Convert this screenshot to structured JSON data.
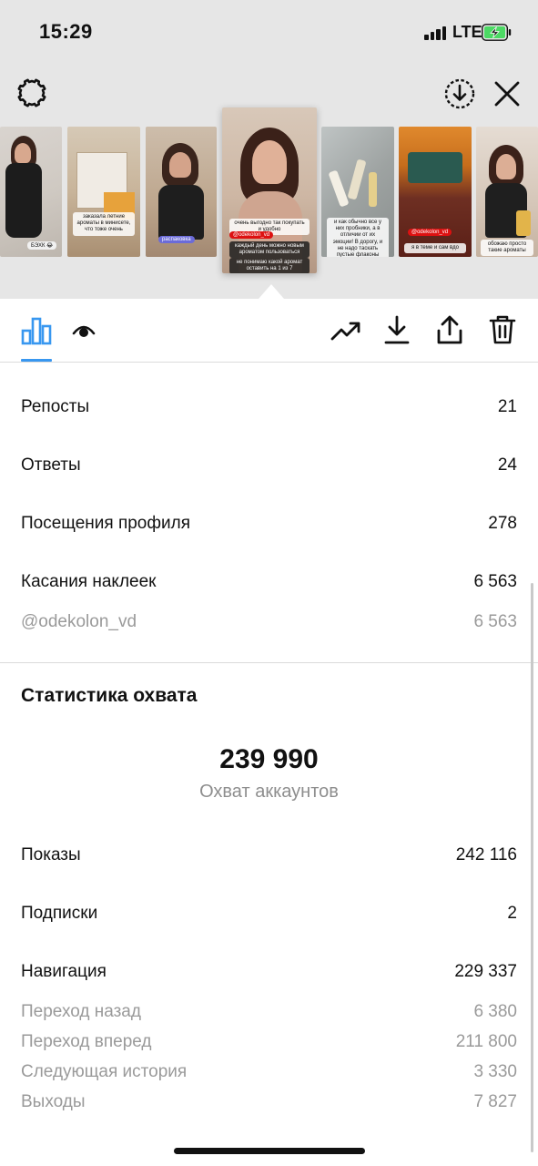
{
  "status_bar": {
    "time": "15:29",
    "network": "LTE"
  },
  "icons": {
    "settings": "gear-icon",
    "save": "download-circle-icon",
    "close": "close-icon",
    "insights": "bar-chart-icon",
    "views": "eye-icon",
    "promote": "trending-up-icon",
    "download": "download-icon",
    "share": "share-icon",
    "delete": "trash-icon"
  },
  "thumbnails": {
    "t1": {
      "sticker": "БЭХК 😂"
    },
    "t2": {
      "caption": "заказала летние ароматы в минисете, что тоже очень"
    },
    "t3": {
      "sticker": "распаковка"
    },
    "t4": {
      "caption1": "очень выгодно так покупать и удобно",
      "tag": "@odekolon_vd",
      "caption2": "каждый день можно новым ароматом пользоваться",
      "caption3": "не понимаю какой аромат оставить на 1 из 7"
    },
    "t5": {
      "caption": "и как обычно все у них пробники, а в отличии от их эмоции! В дорогу, и не надо таскать пустые флаконы"
    },
    "t6": {
      "tag": "@odekolon_vd",
      "caption": "я в теме и сам вдо"
    },
    "t7": {
      "caption": "обожаю просто такие ароматы"
    }
  },
  "stats": {
    "reposts": {
      "label": "Репосты",
      "value": "21"
    },
    "replies": {
      "label": "Ответы",
      "value": "24"
    },
    "profile_visits": {
      "label": "Посещения профиля",
      "value": "278"
    },
    "sticker_taps": {
      "label": "Касания наклеек",
      "value": "6 563"
    },
    "sticker_account": {
      "label": "@odekolon_vd",
      "value": "6 563"
    }
  },
  "reach": {
    "title": "Статистика охвата",
    "accounts_reached": "239 990",
    "accounts_reached_label": "Охват аккаунтов",
    "impressions": {
      "label": "Показы",
      "value": "242 116"
    },
    "follows": {
      "label": "Подписки",
      "value": "2"
    },
    "navigation": {
      "label": "Навигация",
      "value": "229 337"
    },
    "back": {
      "label": "Переход назад",
      "value": "6 380"
    },
    "forward": {
      "label": "Переход вперед",
      "value": "211 800"
    },
    "next_story": {
      "label": "Следующая история",
      "value": "3 330"
    },
    "exits": {
      "label": "Выходы",
      "value": "7 827"
    }
  },
  "colors": {
    "accent": "#3897f0",
    "muted": "#9a9a9a",
    "header_bg": "#e6e6e6",
    "battery_charge": "#4cd964"
  }
}
